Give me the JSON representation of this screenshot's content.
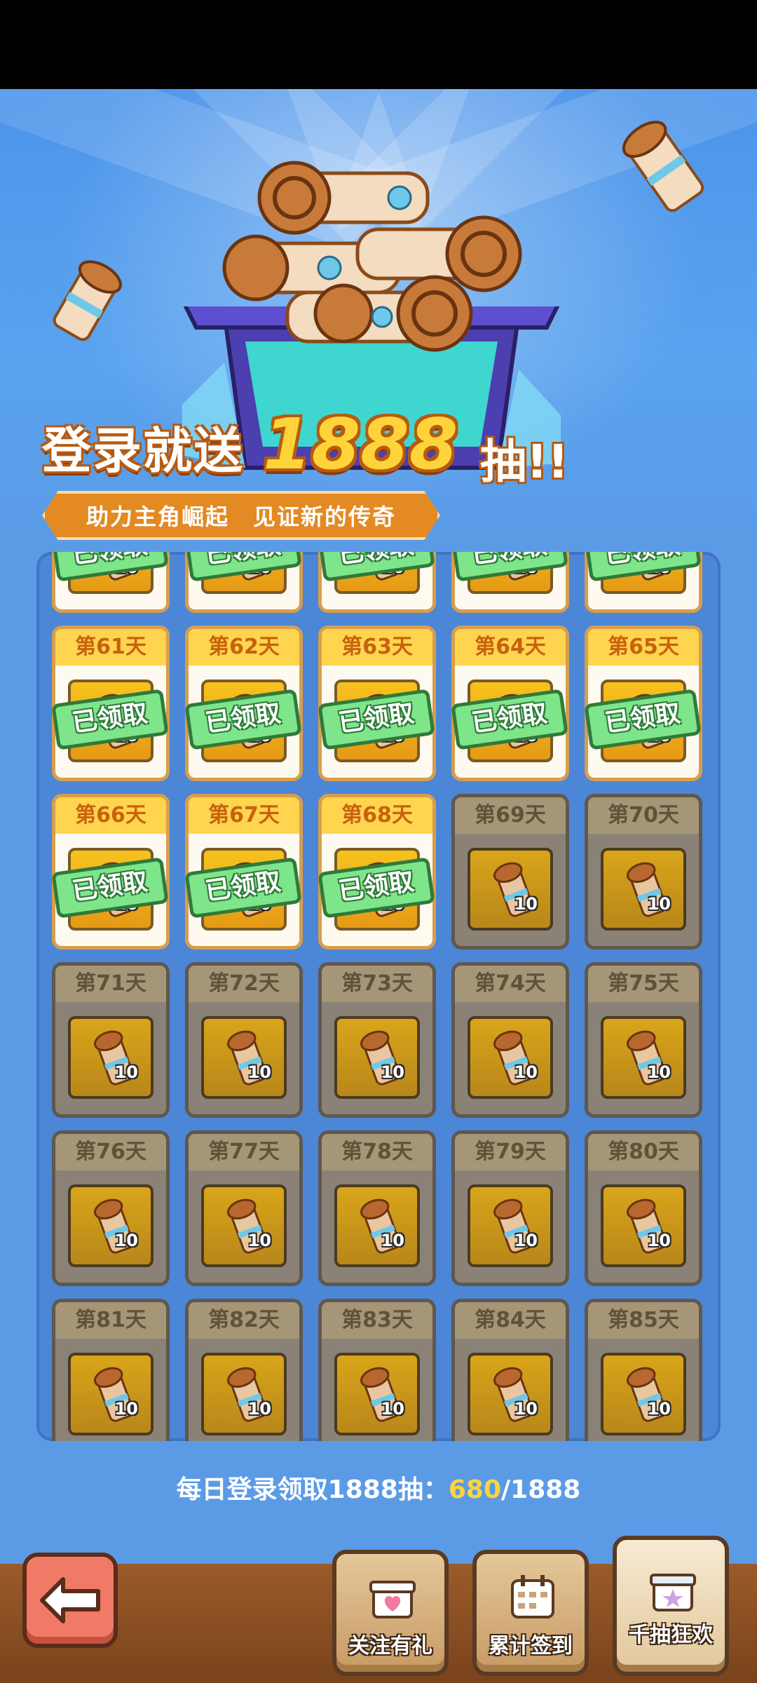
{
  "banner": {
    "headline_prefix": "登录就送",
    "headline_number": "1888",
    "headline_suffix": "抽!!",
    "subtitle": "助力主角崛起　见证新的传奇"
  },
  "grid": {
    "top_row_partial": [
      {
        "stamp": "已领取",
        "qty": "10",
        "state": "claimed"
      },
      {
        "stamp": "已领取",
        "qty": "10",
        "state": "claimed"
      },
      {
        "stamp": "已领取",
        "qty": "10",
        "state": "claimed"
      },
      {
        "stamp": "已领取",
        "qty": "10",
        "state": "claimed"
      },
      {
        "stamp": "已领取",
        "qty": "10",
        "state": "claimed"
      }
    ],
    "rows": [
      [
        {
          "day": "第61天",
          "qty": "10",
          "state": "claimed",
          "stamp": "已领取"
        },
        {
          "day": "第62天",
          "qty": "10",
          "state": "claimed",
          "stamp": "已领取"
        },
        {
          "day": "第63天",
          "qty": "10",
          "state": "claimed",
          "stamp": "已领取"
        },
        {
          "day": "第64天",
          "qty": "10",
          "state": "claimed",
          "stamp": "已领取"
        },
        {
          "day": "第65天",
          "qty": "10",
          "state": "claimed",
          "stamp": "已领取"
        }
      ],
      [
        {
          "day": "第66天",
          "qty": "10",
          "state": "claimed",
          "stamp": "已领取"
        },
        {
          "day": "第67天",
          "qty": "10",
          "state": "claimed",
          "stamp": "已领取"
        },
        {
          "day": "第68天",
          "qty": "10",
          "state": "claimed",
          "stamp": "已领取"
        },
        {
          "day": "第69天",
          "qty": "10",
          "state": "locked"
        },
        {
          "day": "第70天",
          "qty": "10",
          "state": "locked"
        }
      ],
      [
        {
          "day": "第71天",
          "qty": "10",
          "state": "locked"
        },
        {
          "day": "第72天",
          "qty": "10",
          "state": "locked"
        },
        {
          "day": "第73天",
          "qty": "10",
          "state": "locked"
        },
        {
          "day": "第74天",
          "qty": "10",
          "state": "locked"
        },
        {
          "day": "第75天",
          "qty": "10",
          "state": "locked"
        }
      ],
      [
        {
          "day": "第76天",
          "qty": "10",
          "state": "locked"
        },
        {
          "day": "第77天",
          "qty": "10",
          "state": "locked"
        },
        {
          "day": "第78天",
          "qty": "10",
          "state": "locked"
        },
        {
          "day": "第79天",
          "qty": "10",
          "state": "locked"
        },
        {
          "day": "第80天",
          "qty": "10",
          "state": "locked"
        }
      ],
      [
        {
          "day": "第81天",
          "qty": "10",
          "state": "locked"
        },
        {
          "day": "第82天",
          "qty": "10",
          "state": "locked"
        },
        {
          "day": "第83天",
          "qty": "10",
          "state": "locked"
        },
        {
          "day": "第84天",
          "qty": "10",
          "state": "locked"
        },
        {
          "day": "第85天",
          "qty": "10",
          "state": "locked"
        }
      ]
    ]
  },
  "progress": {
    "label": "每日登录领取1888抽：",
    "current": "680",
    "separator": "/",
    "total": "1888"
  },
  "bottom_nav": {
    "back_icon": "back-arrow-icon",
    "tabs": [
      {
        "label": "关注有礼",
        "icon": "gift-heart-icon",
        "active": false
      },
      {
        "label": "累计签到",
        "icon": "calendar-icon",
        "active": false
      },
      {
        "label": "千抽狂欢",
        "icon": "gift-star-icon",
        "active": true
      }
    ]
  },
  "colors": {
    "background": "#5b9be6",
    "claimed_header": "#ffd44e",
    "locked_card": "#8a8276",
    "stamp_green": "#7ee58a",
    "progress_highlight": "#ffd43a",
    "bottom_bar": "#8a4f22"
  }
}
